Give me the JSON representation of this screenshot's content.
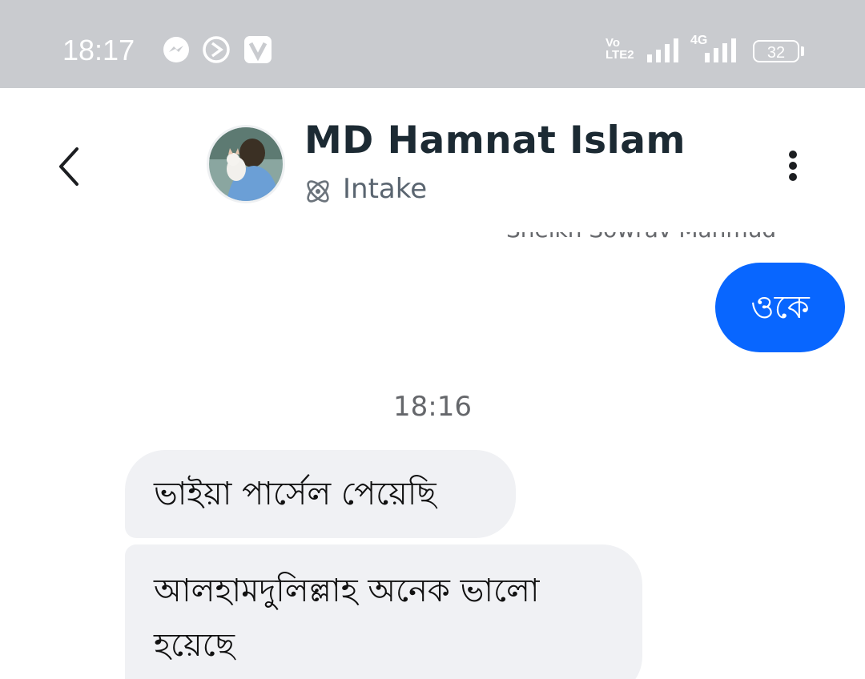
{
  "status_bar": {
    "time": "18:17",
    "network_label": "Vo LTE2",
    "network_type": "4G",
    "battery": "32",
    "notification_icons": [
      "messenger-icon",
      "vpn-icon",
      "v-app-icon"
    ]
  },
  "header": {
    "contact_name": "MD Hamnat Islam",
    "status_label": "Intake"
  },
  "chat": {
    "cut_off_name": "Sheikh Sowrav Mahmud",
    "outgoing_message": "ওকে",
    "timestamp": "18:16",
    "incoming_messages": [
      "ভাইয়া পার্সেল পেয়েছি",
      "আলহামদুলিল্লাহ অনেক ভালো হয়েছে"
    ]
  },
  "colors": {
    "status_bar_bg": "#c9cbcf",
    "outgoing_bubble": "#0866ff",
    "incoming_bubble": "#f0f1f4",
    "name_text": "#1c2a33"
  }
}
